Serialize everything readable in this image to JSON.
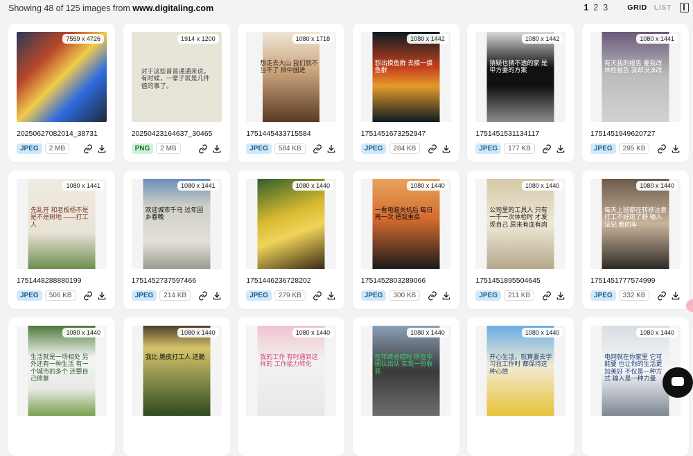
{
  "topbar": {
    "summary_prefix": "Showing 48 of 125 images from",
    "domain": "www.digitaling.com",
    "pages": [
      "1",
      "2",
      "3"
    ],
    "active_page": "1",
    "view_grid": "GRID",
    "view_list": "LIST"
  },
  "cards": [
    {
      "name": "20250627082014_38731",
      "dims": "7559 x 4726",
      "type": "JPEG",
      "size": "2 MB"
    },
    {
      "name": "20250423164637_30465",
      "dims": "1914 x 1200",
      "type": "PNG",
      "size": "2 MB",
      "thumb_text": "对于这些普普通通来说，有时候，一辈子就是几件值的事了。"
    },
    {
      "name": "1751445433715584",
      "dims": "1080 x 1718",
      "type": "JPEG",
      "size": "584 KB",
      "thumb_text": "想走去大山 我们就不当不了 排中国进"
    },
    {
      "name": "1751451673252947",
      "dims": "1080 x 1442",
      "type": "JPEG",
      "size": "284 KB",
      "thumb_text": "想出摸鱼群 去摸一摸 鱼群"
    },
    {
      "name": "1751451531134117",
      "dims": "1080 x 1442",
      "type": "JPEG",
      "size": "177 KB",
      "thumb_text": "猜疑也猜不透的家 是甲方要的方案"
    },
    {
      "name": "1751451949620727",
      "dims": "1080 x 1441",
      "type": "JPEG",
      "size": "295 KB",
      "thumb_text": "有天我的报告 要我改 体检报告 我却没法改"
    },
    {
      "name": "1751448288880199",
      "dims": "1080 x 1441",
      "type": "JPEG",
      "size": "506 KB",
      "thumb_text": "先乱开 和老板杨不是 是不是树地 ——打工人"
    },
    {
      "name": "1751452737597466",
      "dims": "1080 x 1441",
      "type": "JPEG",
      "size": "214 KB",
      "thumb_text": "欢迎城市千马 过年回乡春晚"
    },
    {
      "name": "1751446236728202",
      "dims": "1080 x 1440",
      "type": "JPEG",
      "size": "279 KB"
    },
    {
      "name": "1751452803289066",
      "dims": "1080 x 1440",
      "type": "JPEG",
      "size": "300 KB",
      "thumb_text": "一看电脑关机后 每日 再一次 把我重启"
    },
    {
      "name": "1751451895504645",
      "dims": "1080 x 1440",
      "type": "JPEG",
      "size": "211 KB",
      "thumb_text": "公司里的工具人 只有一千一次体检时 才发现自己 原来有血有肉"
    },
    {
      "name": "1751451777574999",
      "dims": "1080 x 1440",
      "type": "JPEG",
      "size": "332 KB",
      "thumb_text": "每天上班都在转移注意 打工不好跑了野 输入法记 我的车"
    },
    {
      "name": "",
      "dims": "1080 x 1440",
      "type": "",
      "size": "",
      "thumb_text": "生活就是一场相处 另外还有一种生活 有一个城市的多个 还要自己修复"
    },
    {
      "name": "",
      "dims": "1080 x 1440",
      "type": "",
      "size": "",
      "thumb_text": "我比 脆皮打工人 还脆"
    },
    {
      "name": "",
      "dims": "1080 x 1440",
      "type": "",
      "size": "",
      "thumb_text": "我的工作 有时遇到这样的 工作能力转化"
    },
    {
      "name": "",
      "dims": "1080 x 1440",
      "type": "",
      "size": "",
      "thumb_text": "在年终总结时 所在中国认出认 实现一份收获"
    },
    {
      "name": "",
      "dims": "1080 x 1440",
      "type": "",
      "size": "",
      "thumb_text": "开心生活，就算要去学习拉工作时 都保持这种心情"
    },
    {
      "name": "",
      "dims": "1080 x 1440",
      "type": "",
      "size": "",
      "thumb_text": "电网就在你家里 它可能要 也让你的生活更加美好 不仅是一种方式 输入是一种力量"
    }
  ],
  "colors": {
    "jpeg_badge": "#cfe9fb",
    "png_badge": "#cdf2d6",
    "page_bg": "#f3f3f4"
  }
}
